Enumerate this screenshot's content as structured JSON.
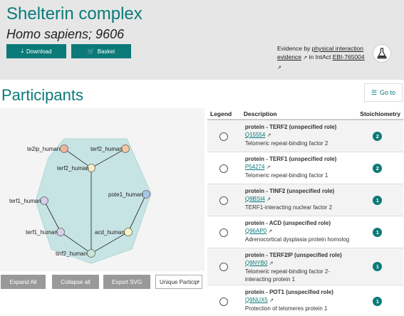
{
  "header": {
    "title": "Shelterin complex",
    "subtitle": "Homo sapiens; 9606",
    "download_label": "Download",
    "basket_label": "Basket",
    "evidence_prefix": "Evidence by ",
    "evidence_link": "physical interaction evidence",
    "evidence_mid": " in IntAct ",
    "intact_id": "EBI-765004"
  },
  "participants": {
    "title": "Participants",
    "goto_label": "Go to"
  },
  "graph": {
    "nodes": [
      {
        "label": "te2ip_human",
        "color": "#f0b49a"
      },
      {
        "label": "terf2_human",
        "color": "#f3c89f"
      },
      {
        "label": "terf2_human",
        "color": "#f7ecc8"
      },
      {
        "label": "pote1_human",
        "color": "#a9c6e6"
      },
      {
        "label": "terf1_human",
        "color": "#d6cde6"
      },
      {
        "label": "terf1_human",
        "color": "#d9cfe6"
      },
      {
        "label": "acd_human",
        "color": "#f9f5c0"
      },
      {
        "label": "tinf2_human",
        "color": "#c8e6d6"
      }
    ],
    "hull_color": "#c7e4e4",
    "buttons": {
      "expand": "Expand All",
      "collapse": "Collapse all",
      "export": "Export SVG",
      "select": "Unique Particip"
    }
  },
  "table": {
    "headers": {
      "legend": "Legend",
      "description": "Description",
      "stoichiometry": "Stoichiometry"
    },
    "rows": [
      {
        "name": "protein - TERF2 (unspecified role)",
        "accession": "Q15554",
        "function": "Telomeric repeat-binding factor 2",
        "stoichiometry": "2"
      },
      {
        "name": "protein - TERF1 (unspecified role)",
        "accession": "P54274",
        "function": "Telomeric repeat-binding factor 1",
        "stoichiometry": "2"
      },
      {
        "name": "protein - TINF2 (unspecified role)",
        "accession": "Q9BSI4",
        "function": "TERF1-interacting nuclear factor 2",
        "stoichiometry": "1"
      },
      {
        "name": "protein - ACD (unspecified role)",
        "accession": "Q96AP0",
        "function": "Adrenocortical dysplasia protein homolog",
        "stoichiometry": "1"
      },
      {
        "name": "protein - TERF2IP (unspecified role)",
        "accession": "Q9NYB0",
        "function": "Telomeric repeat-binding factor 2-interacting protein 1",
        "stoichiometry": "1"
      },
      {
        "name": "protein - POT1 (unspecified role)",
        "accession": "Q9NUX5",
        "function": "Protection of telomeres protein 1",
        "stoichiometry": "1"
      }
    ]
  },
  "colors": {
    "accent": "#0b7a78",
    "title": "#0a7a7a",
    "header_bg": "#e6e6e6"
  }
}
